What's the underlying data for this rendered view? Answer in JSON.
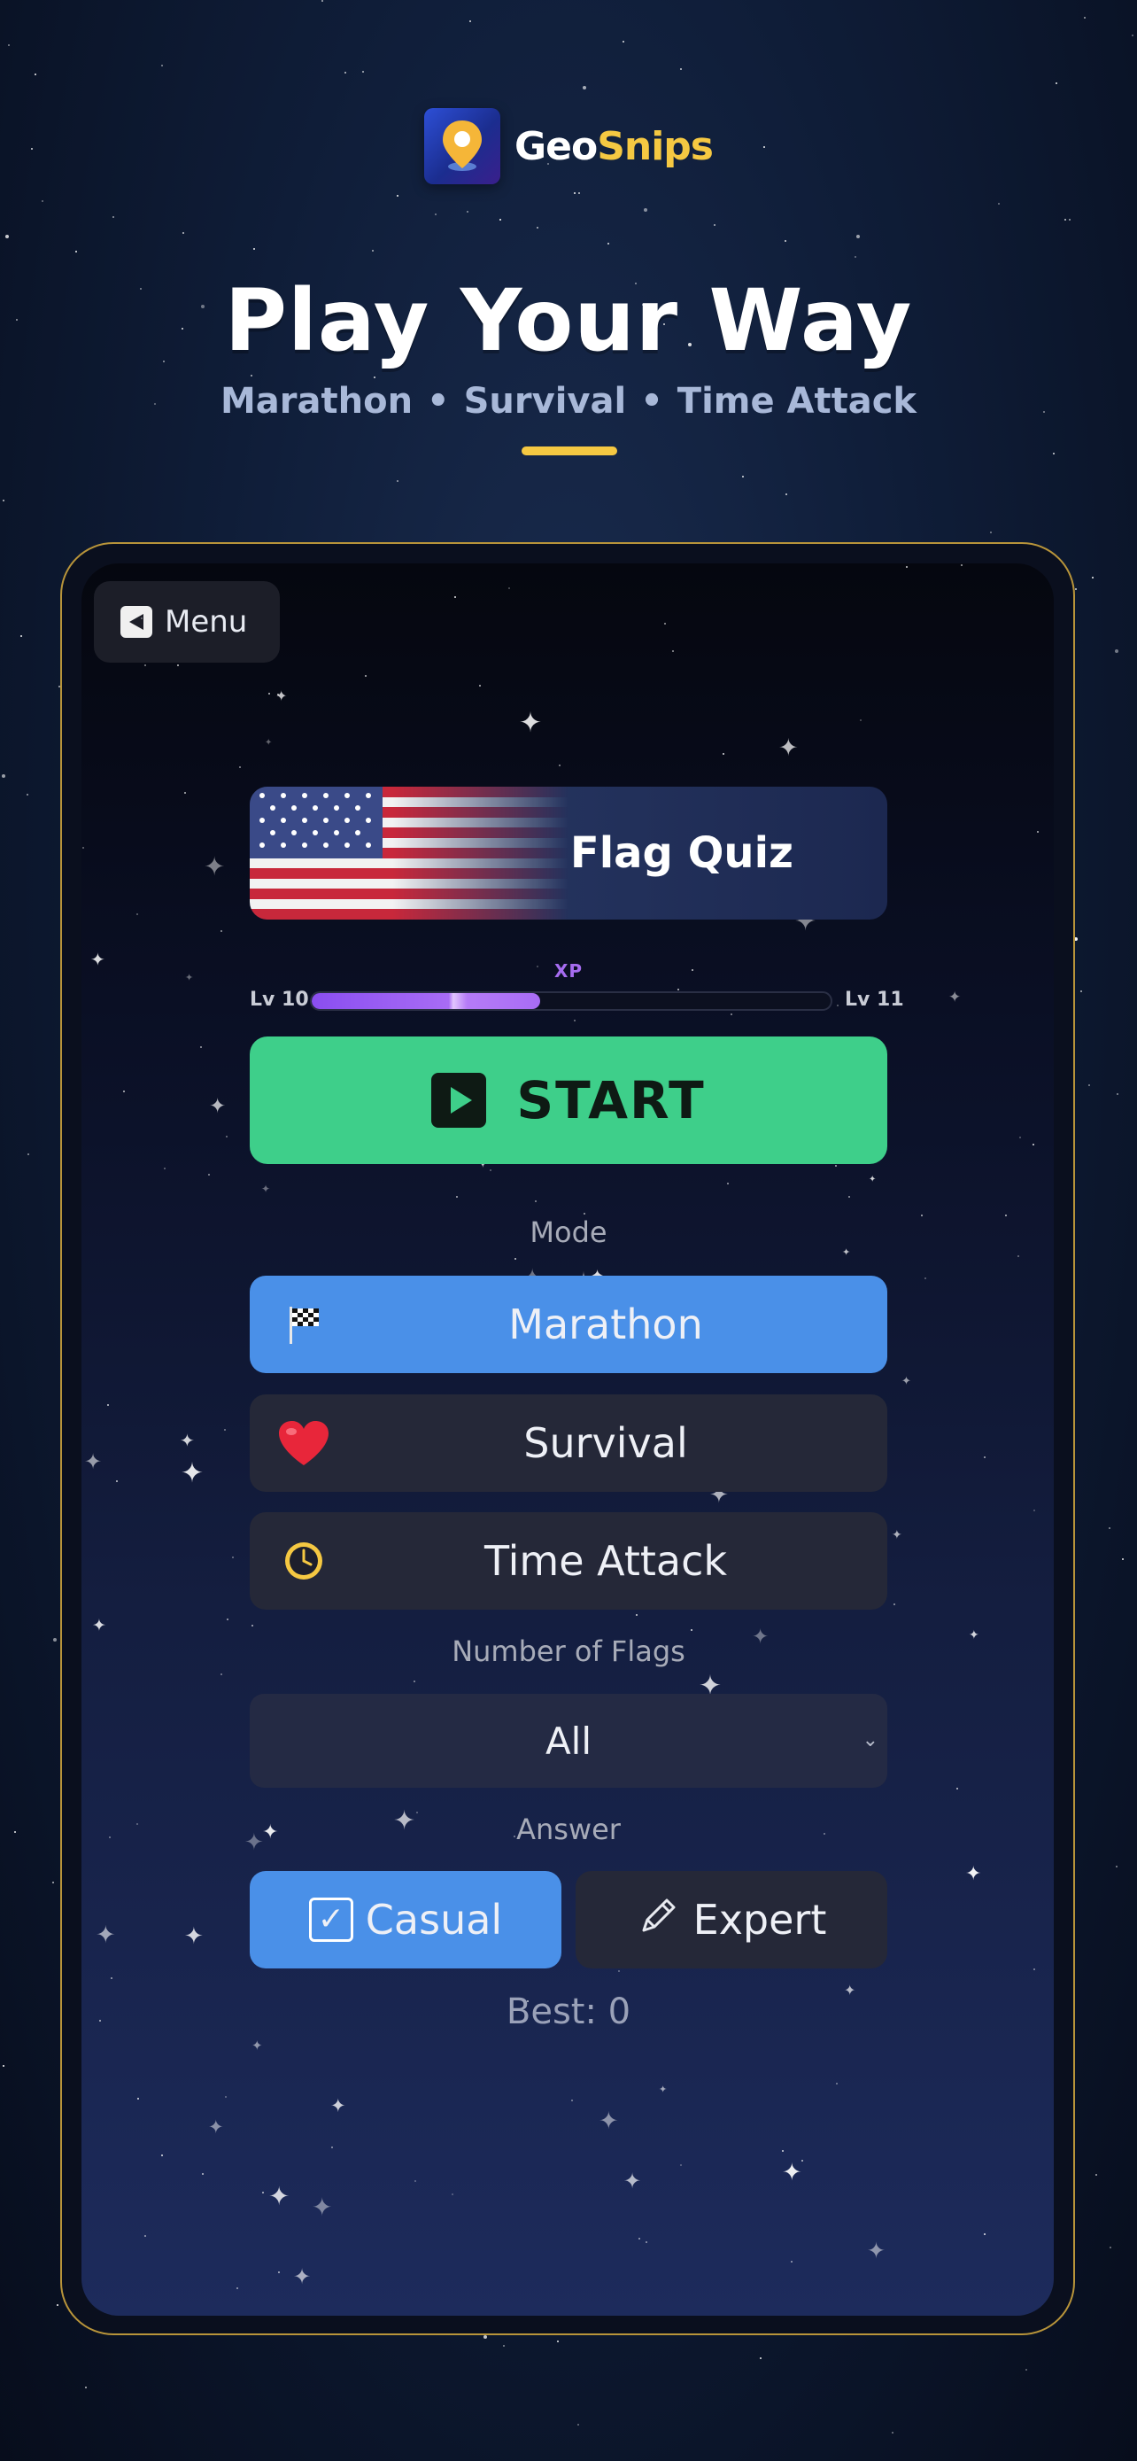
{
  "header": {
    "brand_geo": "Geo",
    "brand_snips": "Snips",
    "headline": "Play Your Way",
    "modes_line": [
      "Marathon",
      "Survival",
      "Time Attack"
    ],
    "separator": "•"
  },
  "app": {
    "menu_label": "Menu",
    "quiz_title": "Flag Quiz",
    "xp_label": "XP",
    "level_current": "Lv 10",
    "level_next": "Lv 11",
    "xp_progress_fraction": 0.44,
    "start_label": "START",
    "mode_section_label": "Mode",
    "modes": [
      {
        "label": "Marathon",
        "icon": "checkered-flag-icon",
        "selected": true
      },
      {
        "label": "Survival",
        "icon": "heart-icon",
        "selected": false
      },
      {
        "label": "Time Attack",
        "icon": "clock-icon",
        "selected": false
      }
    ],
    "flags_section_label": "Number of Flags",
    "flags_selected": "All",
    "answer_section_label": "Answer",
    "answer_casual": "Casual",
    "answer_expert": "Expert",
    "answer_selected": "Casual",
    "best_score_text": "Best: 0"
  },
  "colors": {
    "accent_yellow": "#f5c842",
    "start_green": "#3ecf8a",
    "selected_blue": "#4a90e8",
    "xp_purple": "#a66cf0"
  }
}
